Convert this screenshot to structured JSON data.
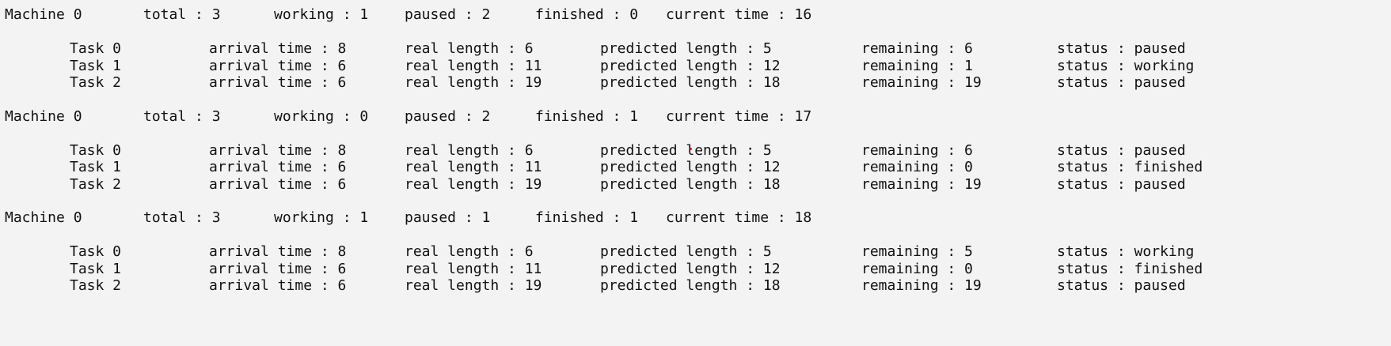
{
  "blocks": [
    {
      "machine": {
        "name": "Machine 0",
        "total": "total : 3",
        "working": "working : 1",
        "paused": "paused : 2",
        "finished": "finished : 0",
        "current_time": "current time : 16"
      },
      "tasks": [
        {
          "name": "Task 0",
          "arrival": "arrival time : 8",
          "real": "real length : 6",
          "predicted": "predicted length : 5",
          "remaining": "remaining : 6",
          "status": "status : paused"
        },
        {
          "name": "Task 1",
          "arrival": "arrival time : 6",
          "real": "real length : 11",
          "predicted": "predicted length : 12",
          "remaining": "remaining : 1",
          "status": "status : working"
        },
        {
          "name": "Task 2",
          "arrival": "arrival time : 6",
          "real": "real length : 19",
          "predicted": "predicted length : 18",
          "remaining": "remaining : 19",
          "status": "status : paused"
        }
      ]
    },
    {
      "machine": {
        "name": "Machine 0",
        "total": "total : 3",
        "working": "working : 0",
        "paused": "paused : 2",
        "finished": "finished : 1",
        "current_time": "current time : 17"
      },
      "tasks": [
        {
          "name": "Task 0",
          "arrival": "arrival time : 8",
          "real": "real length : 6",
          "predicted": "predicted length : 5",
          "remaining": "remaining : 6",
          "status": "status : paused"
        },
        {
          "name": "Task 1",
          "arrival": "arrival time : 6",
          "real": "real length : 11",
          "predicted": "predicted length : 12",
          "remaining": "remaining : 0",
          "status": "status : finished"
        },
        {
          "name": "Task 2",
          "arrival": "arrival time : 6",
          "real": "real length : 19",
          "predicted": "predicted length : 18",
          "remaining": "remaining : 19",
          "status": "status : paused"
        }
      ]
    },
    {
      "machine": {
        "name": "Machine 0",
        "total": "total : 3",
        "working": "working : 1",
        "paused": "paused : 1",
        "finished": "finished : 1",
        "current_time": "current time : 18"
      },
      "tasks": [
        {
          "name": "Task 0",
          "arrival": "arrival time : 8",
          "real": "real length : 6",
          "predicted": "predicted length : 5",
          "remaining": "remaining : 5",
          "status": "status : working"
        },
        {
          "name": "Task 1",
          "arrival": "arrival time : 6",
          "real": "real length : 11",
          "predicted": "predicted length : 12",
          "remaining": "remaining : 0",
          "status": "status : finished"
        },
        {
          "name": "Task 2",
          "arrival": "arrival time : 6",
          "real": "real length : 19",
          "predicted": "predicted length : 18",
          "remaining": "remaining : 19",
          "status": "status : paused"
        }
      ]
    }
  ]
}
